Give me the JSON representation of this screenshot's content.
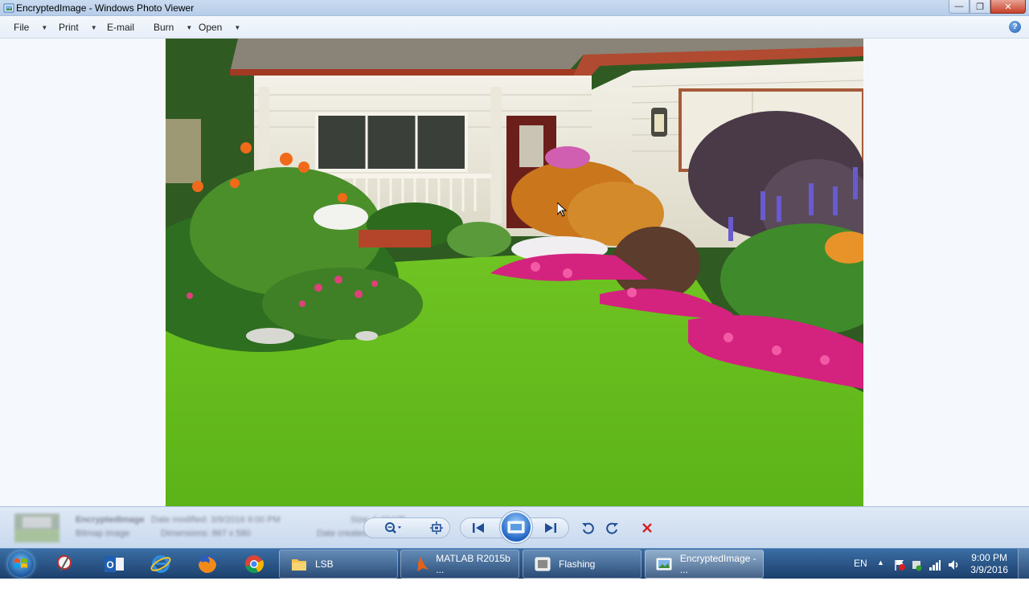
{
  "window": {
    "title": "EncryptedImage - Windows Photo Viewer",
    "minimize": "—",
    "restore": "❐",
    "close": "✕"
  },
  "menu": {
    "file": "File",
    "print": "Print",
    "email": "E-mail",
    "burn": "Burn",
    "open": "Open",
    "help": "?"
  },
  "photo": {
    "subject": "front yard garden with house, flower beds and green lawn"
  },
  "file_info": {
    "name": "EncryptedImage",
    "type": "Bitmap image",
    "date_modified": "Date modified: 3/9/2016 9:00 PM",
    "dimensions": "Dimensions: 867 x 580",
    "size": "Size: 1.43 MB",
    "date_created": "Date created: 3/9/2016"
  },
  "controls": {
    "zoom": "zoom",
    "fit": "actual size",
    "previous": "previous",
    "slideshow": "slide show",
    "next": "next",
    "rotate_ccw": "rotate counterclockwise",
    "rotate_cw": "rotate clockwise",
    "delete": "delete"
  },
  "taskbar": {
    "tasks": [
      {
        "label": "LSB"
      },
      {
        "label": "MATLAB R2015b ..."
      },
      {
        "label": "Flashing"
      },
      {
        "label": "EncryptedImage - ..."
      }
    ],
    "language": "EN",
    "time": "9:00 PM",
    "date": "3/9/2016"
  },
  "colors": {
    "titlebar": "#c9dbf0",
    "taskbar": "#1c3f6c",
    "accent": "#2266c4",
    "delete": "#d42020"
  }
}
